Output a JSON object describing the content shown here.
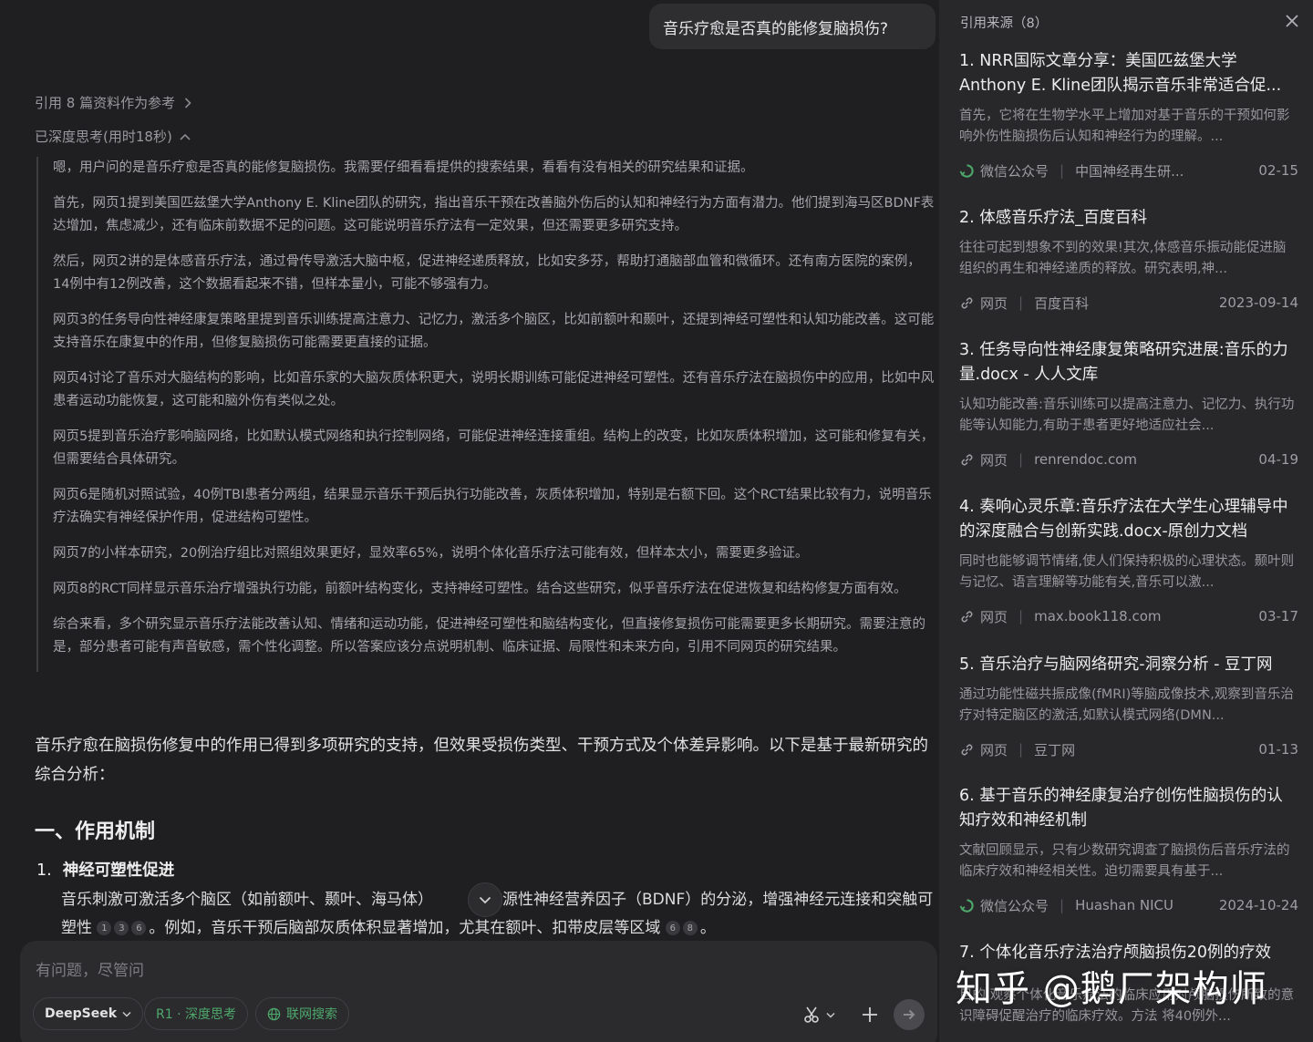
{
  "user_message": "音乐疗愈是否真的能修复脑损伤?",
  "refs_link": "引用 8 篇资料作为参考",
  "think_toggle": "已深度思考(用时18秒)",
  "thinking": [
    "嗯，用户问的是音乐疗愈是否真的能修复脑损伤。我需要仔细看看提供的搜索结果，看看有没有相关的研究结果和证据。",
    "首先，网页1提到美国匹兹堡大学Anthony E. Kline团队的研究，指出音乐干预在改善脑外伤后的认知和神经行为方面有潜力。他们提到海马区BDNF表达增加，焦虑减少，还有临床前数据不足的问题。这可能说明音乐疗法有一定效果，但还需要更多研究支持。",
    "然后，网页2讲的是体感音乐疗法，通过骨传导激活大脑中枢，促进神经递质释放，比如安多芬，帮助打通脑部血管和微循环。还有南方医院的案例，14例中有12例改善，这个数据看起来不错，但样本量小，可能不够强有力。",
    "网页3的任务导向性神经康复策略里提到音乐训练提高注意力、记忆力，激活多个脑区，比如前额叶和颞叶，还提到神经可塑性和认知功能改善。这可能支持音乐在康复中的作用，但修复脑损伤可能需要更直接的证据。",
    "网页4讨论了音乐对大脑结构的影响，比如音乐家的大脑灰质体积更大，说明长期训练可能促进神经可塑性。还有音乐疗法在脑损伤中的应用，比如中风患者运动功能恢复，这可能和脑外伤有类似之处。",
    "网页5提到音乐治疗影响脑网络，比如默认模式网络和执行控制网络，可能促进神经连接重组。结构上的改变，比如灰质体积增加，这可能和修复有关，但需要结合具体研究。",
    "网页6是随机对照试验，40例TBI患者分两组，结果显示音乐干预后执行功能改善，灰质体积增加，特别是右额下回。这个RCT结果比较有力，说明音乐疗法确实有神经保护作用，促进结构可塑性。",
    "网页7的小样本研究，20例治疗组比对照组效果更好，显效率65%，说明个体化音乐疗法可能有效，但样本太小，需要更多验证。",
    "网页8的RCT同样显示音乐治疗增强执行功能，前额叶结构变化，支持神经可塑性。结合这些研究，似乎音乐疗法在促进恢复和结构修复方面有效。",
    "综合来看，多个研究显示音乐疗法能改善认知、情绪和运动功能，促进神经可塑性和脑结构变化，但直接修复损伤可能需要更多长期研究。需要注意的是，部分患者可能有声音敏感，需个性化调整。所以答案应该分点说明机制、临床证据、局限性和未来方向，引用不同网页的研究结果。"
  ],
  "answer": {
    "intro": "音乐疗愈在脑损伤修复中的作用已得到多项研究的支持，但效果受损伤类型、干预方式及个体差异影响。以下是基于最新研究的综合分析：",
    "section_title": "一、作用机制",
    "item_number": "1.",
    "item_title": "神经可塑性促进",
    "item_body_1": "音乐刺激可激活多个脑区（如前额叶、颞叶、海马体）",
    "item_body_2": "进脑源性神经营养因子（BDNF）的分泌，增强神经元连接和突触可塑性",
    "item_body_3": "。例如，音乐干预后脑部灰质体积显著增加，尤其在额叶、扣带皮层等区域",
    "item_body_4": "。",
    "cites_a": [
      "1",
      "3",
      "6"
    ],
    "cites_b": [
      "6",
      "8"
    ]
  },
  "input": {
    "placeholder": "有问题，尽管问",
    "model_label": "DeepSeek",
    "r1_label": "R1 · 深度思考",
    "web_label": "联网搜索"
  },
  "panel": {
    "title": "引用来源（8）",
    "sources": [
      {
        "title": "1. NRR国际文章分享：美国匹兹堡大学Anthony E. Kline团队揭示音乐非常适合促...",
        "snippet": "首先，它将在生物学水平上增加对基于音乐的干预如何影响外伤性脑损伤后认知和神经行为的理解。...",
        "type": "微信公众号",
        "site": "中国神经再生研...",
        "date": "02-15",
        "icon": "wechat-icon"
      },
      {
        "title": "2. 体感音乐疗法_百度百科",
        "snippet": "往往可起到想象不到的效果!其次,体感音乐振动能促进脑组织的再生和神经递质的释放。研究表明,神...",
        "type": "网页",
        "site": "百度百科",
        "date": "2023-09-14",
        "icon": "link-icon"
      },
      {
        "title": "3. 任务导向性神经康复策略研究进展:音乐的力量.docx - 人人文库",
        "snippet": "认知功能改善:音乐训练可以提高注意力、记忆力、执行功能等认知能力,有助于患者更好地适应社会...",
        "type": "网页",
        "site": "renrendoc.com",
        "date": "04-19",
        "icon": "link-icon"
      },
      {
        "title": "4. 奏响心灵乐章:音乐疗法在大学生心理辅导中的深度融合与创新实践.docx-原创力文档",
        "snippet": "同时也能够调节情绪,使人们保持积极的心理状态。颞叶则与记忆、语言理解等功能有关,音乐可以激...",
        "type": "网页",
        "site": "max.book118.com",
        "date": "03-17",
        "icon": "link-icon"
      },
      {
        "title": "5. 音乐治疗与脑网络研究-洞察分析 - 豆丁网",
        "snippet": "通过功能性磁共振成像(fMRI)等脑成像技术,观察到音乐治疗对特定脑区的激活,如默认模式网络(DMN...",
        "type": "网页",
        "site": "豆丁网",
        "date": "01-13",
        "icon": "link-icon"
      },
      {
        "title": "6. 基于音乐的神经康复治疗创伤性脑损伤的认知疗效和神经机制",
        "snippet": "文献回顾显示，只有少数研究调查了脑损伤后音乐疗法的临床疗效和神经相关性。迫切需要具有基于...",
        "type": "微信公众号",
        "site": "Huashan NICU",
        "date": "2024-10-24",
        "icon": "wechat-icon"
      },
      {
        "title": "7. 个体化音乐疗法治疗颅脑损伤20例的疗效",
        "snippet": "目的 观察个体化音乐疗法的临床应用对颅脑损伤所致的意识障碍促醒治疗的临床疗效。方法 将40例外...",
        "type": "",
        "site": "",
        "date": "",
        "icon": ""
      }
    ]
  },
  "watermark": "知乎 @鹅厂架构师"
}
